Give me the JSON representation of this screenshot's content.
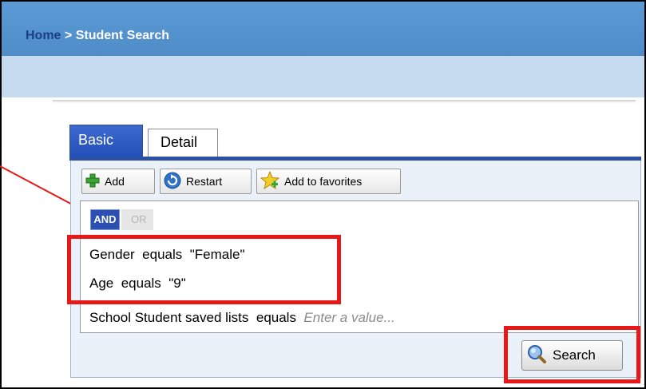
{
  "breadcrumb": {
    "home": "Home",
    "separator": " > ",
    "current": "Student Search"
  },
  "tabs": [
    {
      "label": "Basic",
      "active": true
    },
    {
      "label": "Detail",
      "active": false
    }
  ],
  "toolbar": {
    "add_label": "Add",
    "restart_label": "Restart",
    "favorites_label": "Add to favorites"
  },
  "logic": {
    "and_label": "AND",
    "or_label": "OR",
    "selected": "AND"
  },
  "criteria": [
    {
      "field": "Gender",
      "operator": "equals",
      "value": "\"Female\""
    },
    {
      "field": "Age",
      "operator": "equals",
      "value": "\"9\""
    },
    {
      "field": "School Student saved lists",
      "operator": "equals",
      "placeholder": "Enter a value..."
    }
  ],
  "search": {
    "label": "Search"
  },
  "colors": {
    "header": "#5b9bd5",
    "subbar": "#c6dbef",
    "tab_active": "#2250b8",
    "highlight": "#e81818"
  },
  "icons": {
    "add": "plus-icon",
    "restart": "refresh-icon",
    "favorites": "star-add-icon",
    "search": "magnifier-icon"
  }
}
